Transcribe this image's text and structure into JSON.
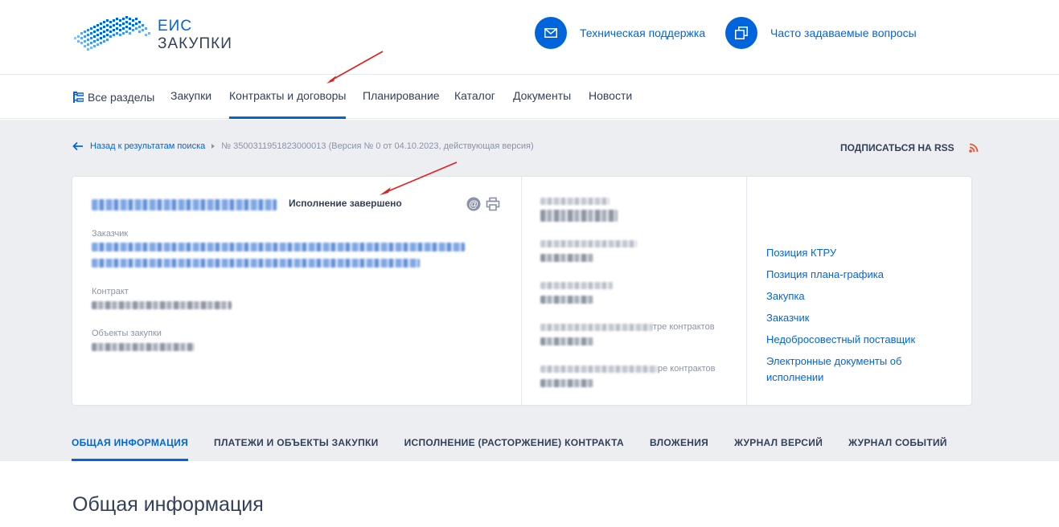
{
  "logo": {
    "line1": "ЕИС",
    "line2": "ЗАКУПКИ"
  },
  "header_links": [
    {
      "label": "Техническая поддержка",
      "icon": "mail-icon"
    },
    {
      "label": "Часто задаваемые вопросы",
      "icon": "copy-icon"
    }
  ],
  "nav": {
    "items": [
      {
        "label": "Все разделы",
        "icon": "sections-tree-icon"
      },
      {
        "label": "Закупки"
      },
      {
        "label": "Контракты и договоры",
        "active": true
      },
      {
        "label": "Планирование"
      },
      {
        "label": "Каталог"
      },
      {
        "label": "Документы"
      },
      {
        "label": "Новости"
      }
    ]
  },
  "breadcrumb": {
    "back": "Назад к результатам поиска",
    "current": "№ 3500311951823000013 (Версия № 0 от 04.10.2023, действующая версия)"
  },
  "rss": {
    "label": "ПОДПИСАТЬСЯ НА RSS",
    "icon": "rss-icon"
  },
  "card": {
    "status": "Исполнение завершено",
    "left": {
      "customer_label": "Заказчик",
      "contract_label": "Контракт",
      "objects_label": "Объекты закупки"
    },
    "middle": {
      "label3_suffix": "тре контрактов",
      "label4_suffix": "ре контрактов"
    },
    "links": [
      "Позиция КТРУ",
      "Позиция плана-графика",
      "Закупка",
      "Заказчик",
      "Недобросовестный поставщик",
      "Электронные документы об исполнении"
    ]
  },
  "tabs": [
    {
      "label": "ОБЩАЯ ИНФОРМАЦИЯ",
      "active": true
    },
    {
      "label": "ПЛАТЕЖИ И ОБЪЕКТЫ ЗАКУПКИ"
    },
    {
      "label": "ИСПОЛНЕНИЕ (РАСТОРЖЕНИЕ) КОНТРАКТА"
    },
    {
      "label": "ВЛОЖЕНИЯ"
    },
    {
      "label": "ЖУРНАЛ ВЕРСИЙ"
    },
    {
      "label": "ЖУРНАЛ СОБЫТИЙ"
    }
  ],
  "section_title": "Общая информация",
  "colors": {
    "accent": "#0065dd",
    "text": "#334059",
    "muted": "#8a92a6",
    "bg_gray": "#eceef2",
    "rss": "#e8542c",
    "annotation": "#e0201f"
  }
}
